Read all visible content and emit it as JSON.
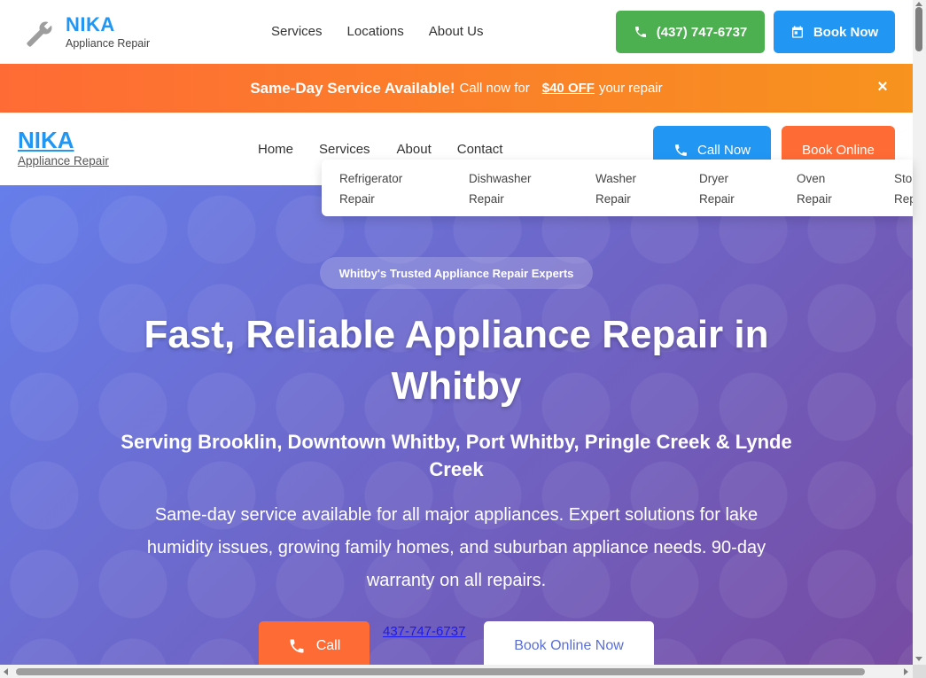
{
  "header": {
    "brand_name": "NIKA",
    "brand_sub": "Appliance Repair",
    "logo_icon": "wrench-icon",
    "nav": [
      "Services",
      "Locations",
      "About Us"
    ],
    "phone_label": "(437) 747-6737",
    "book_label": "Book Now"
  },
  "promo": {
    "strong": "Same-Day Service Available!",
    "mid": "Call now for",
    "off": "$40 OFF",
    "end": "your repair",
    "close": "×"
  },
  "secondary_nav": {
    "brand_name": "NIKA",
    "brand_sub": "Appliance Repair",
    "links": [
      "Home",
      "Services",
      "About",
      "Contact"
    ],
    "call_now": "Call Now",
    "book_online": "Book Online"
  },
  "services_dropdown": [
    [
      "Refrigerator",
      "Repair"
    ],
    [
      "Dishwasher",
      "Repair"
    ],
    [
      "Washer",
      "Repair"
    ],
    [
      "Dryer",
      "Repair"
    ],
    [
      "Oven",
      "Repair"
    ],
    [
      "Sto",
      "Rep"
    ]
  ],
  "hero": {
    "badge": "Whitby's Trusted Appliance Repair Experts",
    "title": "Fast, Reliable Appliance Repair in Whitby",
    "subtitle": "Serving Brooklin, Downtown Whitby, Port Whitby, Pringle Creek & Lynde Creek",
    "description": "Same-day service available for all major appliances. Expert solutions for lake humidity issues, growing family homes, and suburban appliance needs. 90-day warranty on all repairs.",
    "call_label": "Call",
    "phone_link": "437-747-6737",
    "book_label": "Book Online Now"
  },
  "colors": {
    "brand_blue": "#2196f3",
    "green": "#4caf50",
    "orange": "#ff6b35",
    "hero_gradient_start": "#667eea",
    "hero_gradient_end": "#764ba2"
  }
}
